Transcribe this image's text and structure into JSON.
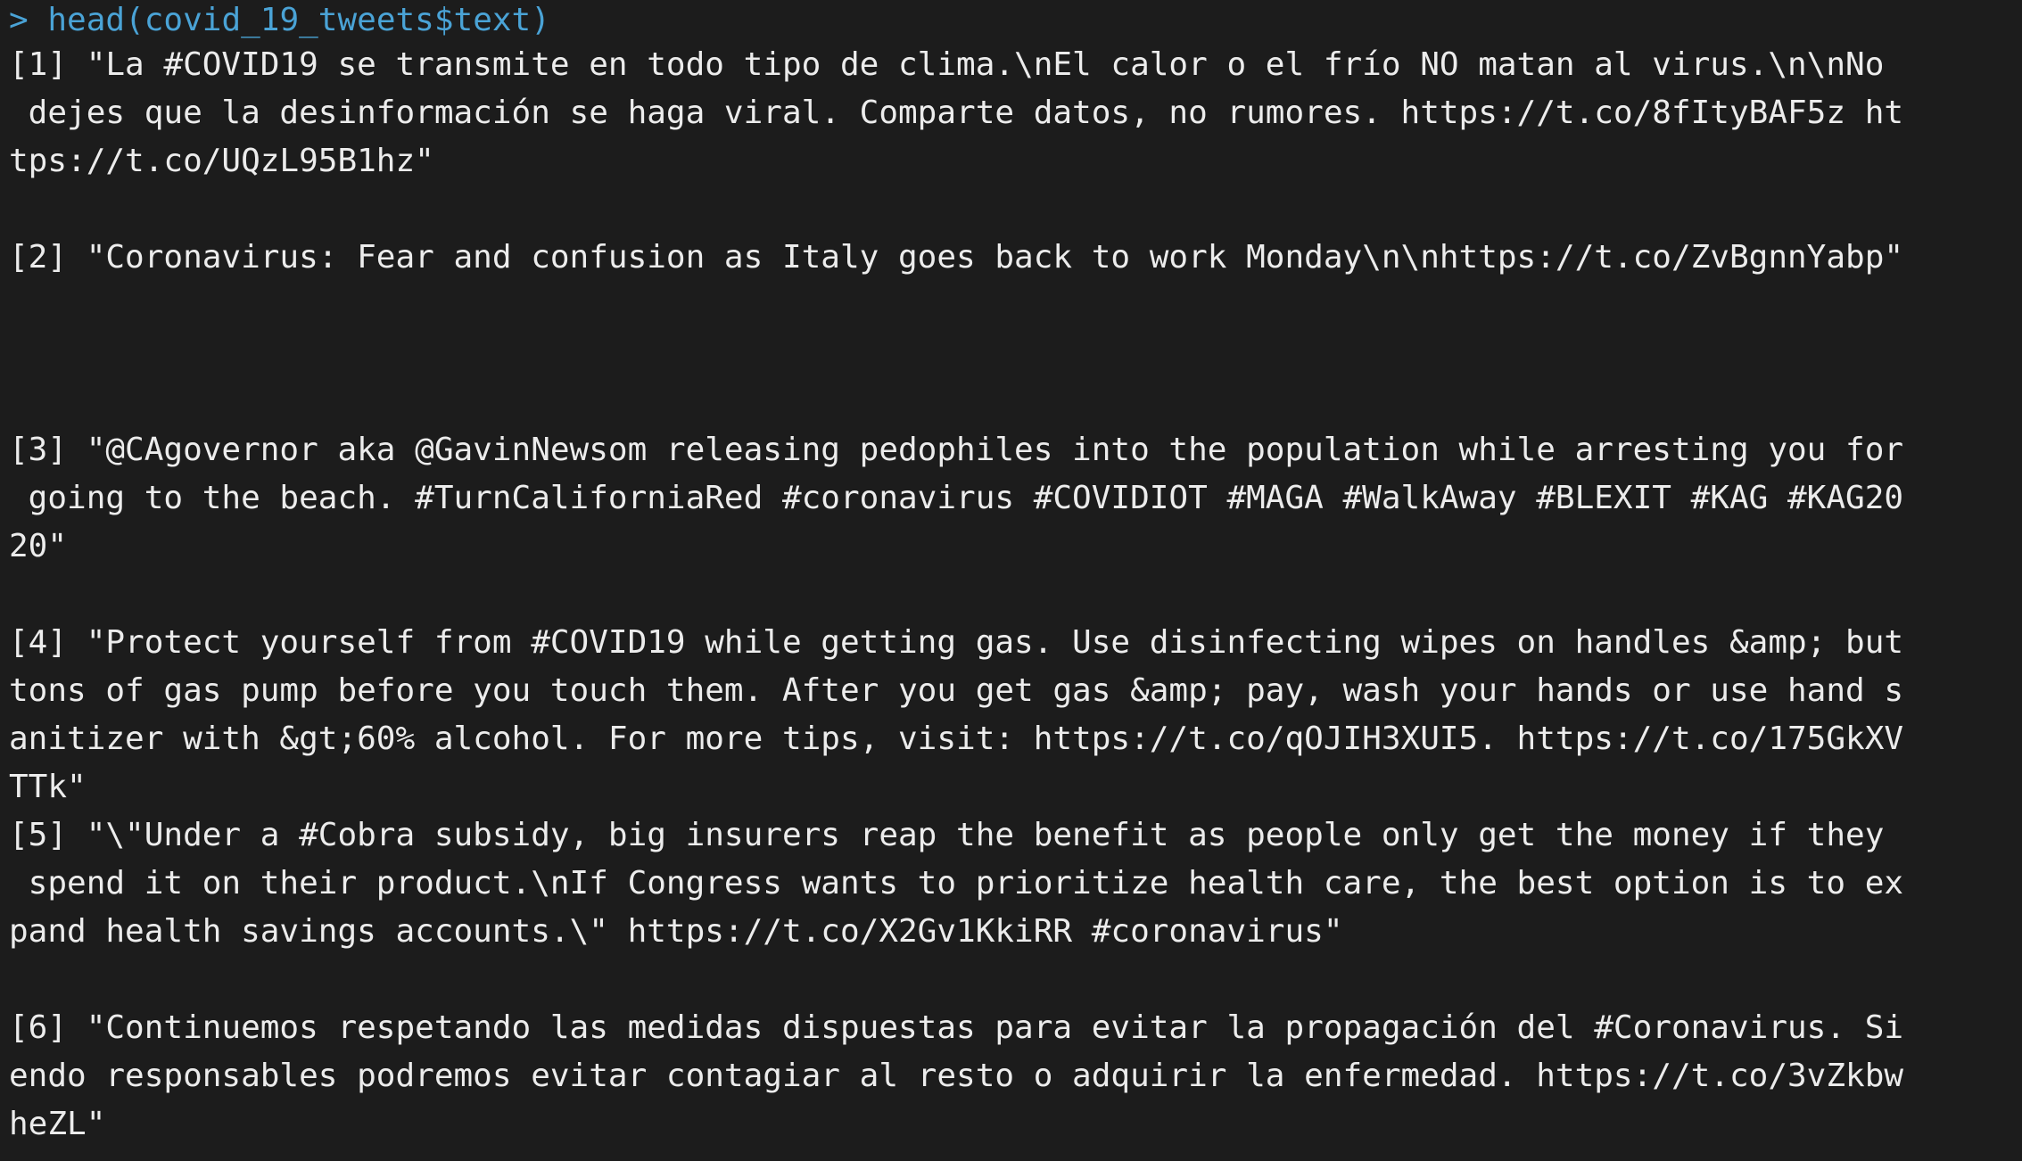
{
  "console": {
    "prompt_symbol": ">",
    "command": "head(covid_19_tweets$text)",
    "output": [
      {
        "lines": [
          "[1] \"La #COVID19 se transmite en todo tipo de clima.\\nEl calor o el frío NO matan al virus.\\n\\nNo",
          " dejes que la desinformación se haga viral. Comparte datos, no rumores. https://t.co/8fItyBAF5z ht",
          "tps://t.co/UQzL95B1hz\""
        ]
      },
      {
        "lines": [
          "[2] \"Coronavirus: Fear and confusion as Italy goes back to work Monday\\n\\nhttps://t.co/ZvBgnnYabp\""
        ]
      },
      {
        "lines": [
          "[3] \"@CAgovernor aka @GavinNewsom releasing pedophiles into the population while arresting you for",
          " going to the beach. #TurnCaliforniaRed #coronavirus #COVIDIOT #MAGA #WalkAway #BLEXIT #KAG #KAG20",
          "20\""
        ]
      },
      {
        "lines": [
          "[4] \"Protect yourself from #COVID19 while getting gas. Use disinfecting wipes on handles &amp; but",
          "tons of gas pump before you touch them. After you get gas &amp; pay, wash your hands or use hand s",
          "anitizer with &gt;60% alcohol. For more tips, visit: https://t.co/qOJIH3XUI5. https://t.co/175GkXV",
          "TTk\""
        ]
      },
      {
        "lines": [
          "[5] \"\\\"Under a #Cobra subsidy, big insurers reap the benefit as people only get the money if they",
          " spend it on their product.\\nIf Congress wants to prioritize health care, the best option is to ex",
          "pand health savings accounts.\\\" https://t.co/X2Gv1KkiRR #coronavirus\""
        ]
      },
      {
        "lines": [
          "[6] \"Continuemos respetando las medidas dispuestas para evitar la propagación del #Coronavirus. Si",
          "endo responsables podremos evitar contagiar al resto o adquirir la enfermedad. https://t.co/3vZkbw",
          "heZL\""
        ]
      }
    ],
    "colors": {
      "background": "#1c1c1c",
      "prompt": "#4aa3d6",
      "output_text": "#e8e8e8"
    }
  }
}
